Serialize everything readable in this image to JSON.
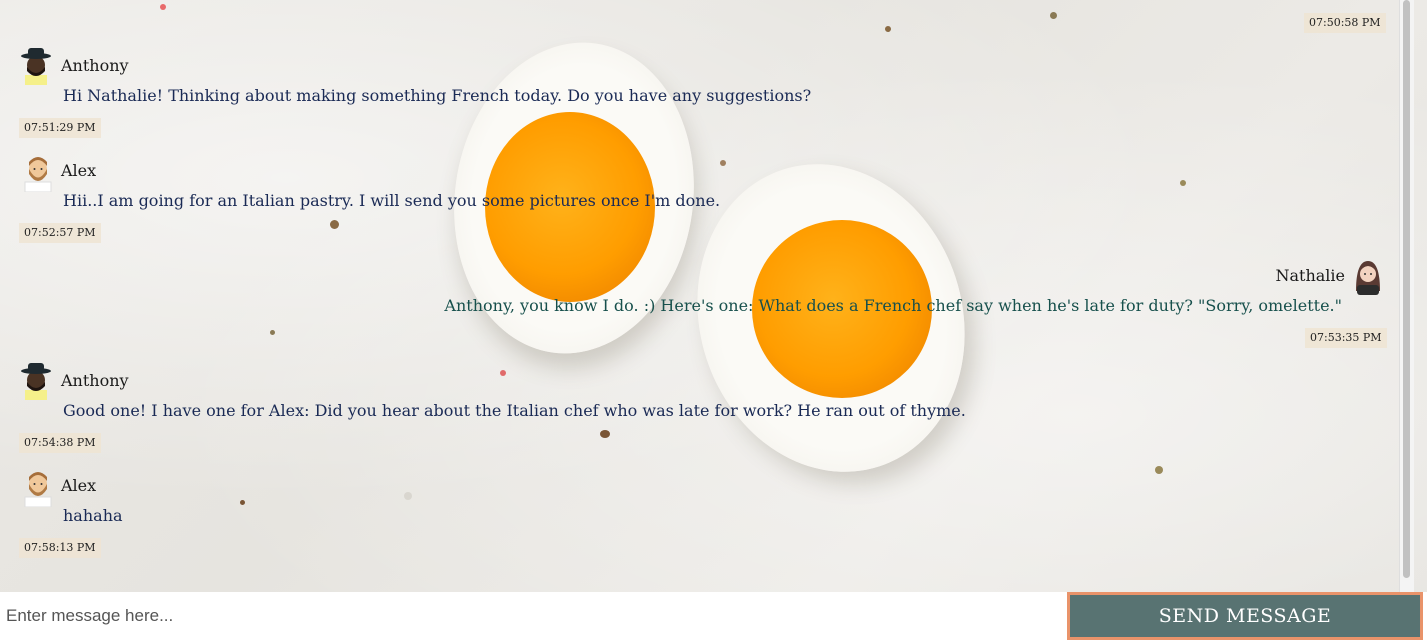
{
  "messages": [
    {
      "type": "timestamp-only",
      "time": "07:50:58 PM"
    },
    {
      "author": "Anthony",
      "avatar": "anthony-avatar",
      "text": "Hi Nathalie! Thinking about making something French today. Do you have any suggestions?",
      "time": "07:51:29 PM",
      "side": "left"
    },
    {
      "author": "Alex",
      "avatar": "alex-avatar",
      "text": "Hii..I am going for an Italian pastry. I will send you some pictures once I'm done.",
      "time": "07:52:57 PM",
      "side": "left"
    },
    {
      "author": "Nathalie",
      "avatar": "nathalie-avatar",
      "text": "Anthony, you know I do. :) Here's one: What does a French chef say when he's late for duty? \"Sorry, omelette.\"",
      "time": "07:53:35 PM",
      "side": "right"
    },
    {
      "author": "Anthony",
      "avatar": "anthony-avatar",
      "text": "Good one! I have one for Alex: Did you hear about the Italian chef who was late for work? He ran out of thyme.",
      "time": "07:54:38 PM",
      "side": "left"
    },
    {
      "author": "Alex",
      "avatar": "alex-avatar",
      "text": "hahaha",
      "time": "07:58:13 PM",
      "side": "left"
    }
  ],
  "composer": {
    "placeholder": "Enter message here...",
    "value": "",
    "send_label": "SEND MESSAGE"
  },
  "colors": {
    "send_button_bg": "#587372",
    "send_button_border": "#e9936a",
    "other_text": "#1a2a55",
    "self_text": "#17504c",
    "timestamp_bg": "#eee4d2"
  }
}
